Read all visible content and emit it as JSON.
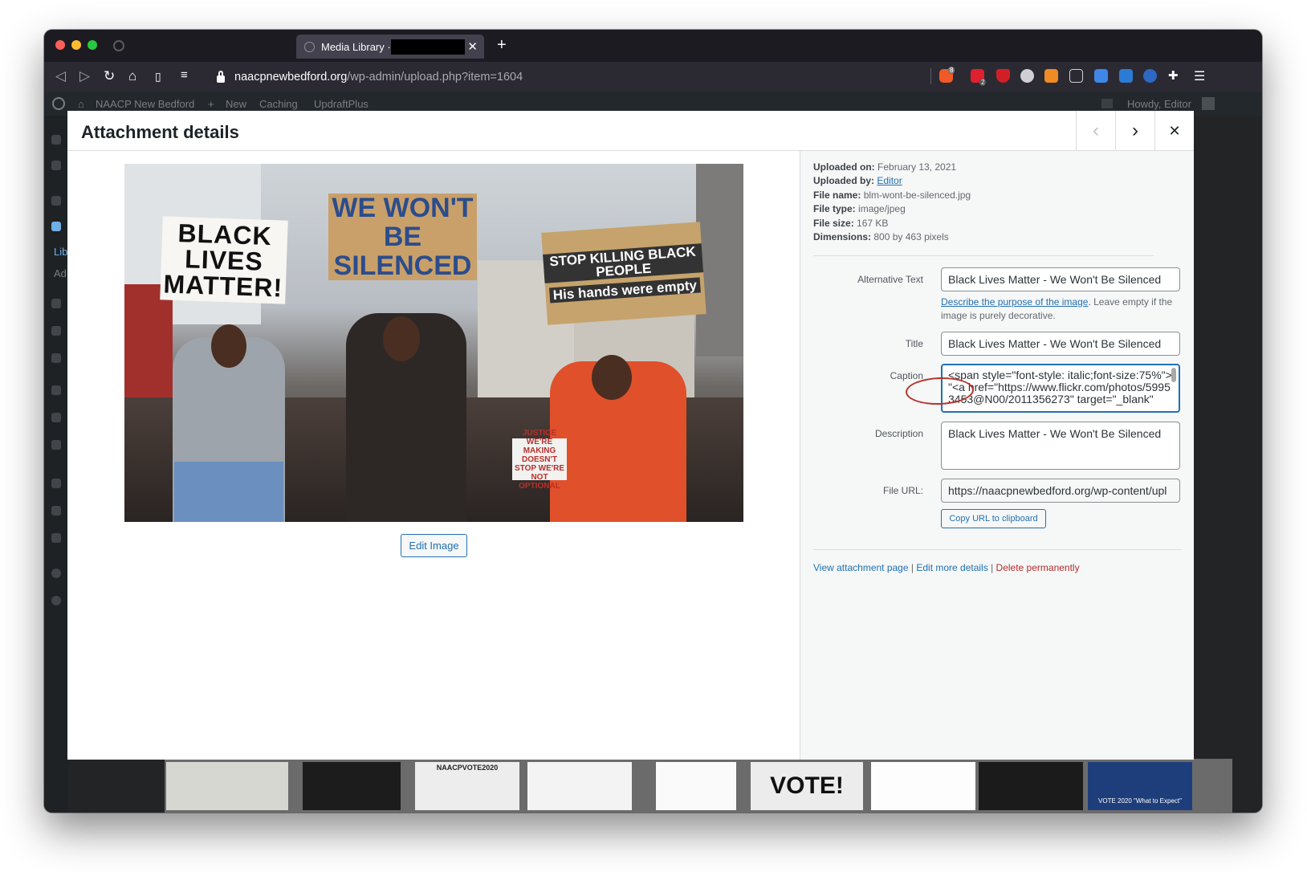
{
  "browser": {
    "tab_title": "Media Library ·",
    "url_host": "naacpnewbedford.org",
    "url_path": "/wp-admin/upload.php?item=1604",
    "brave_badge": "8",
    "ext_badge": "2"
  },
  "admin_bar": {
    "site_name": "NAACP New Bedford",
    "new_label": "New",
    "caching_label": "Caching",
    "updraft_label": "UpdraftPlus",
    "howdy": "Howdy, Editor"
  },
  "sidebar": {
    "lib_label": "Lib",
    "add_label": "Ad"
  },
  "modal": {
    "title": "Attachment details",
    "prev_icon": "‹",
    "next_icon": "›",
    "close_icon": "✕",
    "edit_image_label": "Edit Image"
  },
  "photo": {
    "sign1": "BLACK LIVES MATTER!",
    "sign2": "WE WON'T BE SILENCED",
    "sign3_a": "STOP KILLING BLACK PEOPLE",
    "sign3_b": "His hands were empty",
    "sign4": "JUSTICE WE'RE MAKING DOESN'T STOP WE'RE NOT OPTIONAL"
  },
  "info": {
    "uploaded_on_label": "Uploaded on:",
    "uploaded_on": "February 13, 2021",
    "uploaded_by_label": "Uploaded by:",
    "uploaded_by": "Editor",
    "file_name_label": "File name:",
    "file_name": "blm-wont-be-silenced.jpg",
    "file_type_label": "File type:",
    "file_type": "image/jpeg",
    "file_size_label": "File size:",
    "file_size": "167 KB",
    "dimensions_label": "Dimensions:",
    "dimensions": "800 by 463 pixels"
  },
  "fields": {
    "alt_label": "Alternative Text",
    "alt_value": "Black Lives Matter - We Won't Be Silenced",
    "alt_help_link": "Describe the purpose of the image",
    "alt_help_rest": ". Leave empty if the image is purely decorative.",
    "title_label": "Title",
    "title_value": "Black Lives Matter - We Won't Be Silenced",
    "caption_label": "Caption",
    "caption_value": "<span style=\"font-style: italic;font-size:75%\"> \"<a href=\"https://www.flickr.com/photos/59953453@N00/2011356273\" target=\"_blank\"",
    "description_label": "Description",
    "description_value": "Black Lives Matter - We Won't Be Silenced",
    "file_url_label": "File URL:",
    "file_url_value": "https://naacpnewbedford.org/wp-content/upl",
    "copy_url_label": "Copy URL to clipboard"
  },
  "actions": {
    "view_page": "View attachment page",
    "edit_details": "Edit more details",
    "delete": "Delete permanently",
    "sep": "|"
  },
  "thumbnails": {
    "vote_text": "VOTE!",
    "naacpvote_text": "NAACPVOTE2020",
    "expect_text": "VOTE 2020 \"What to Expect\""
  },
  "colors": {
    "accent": "#2271b1",
    "delete": "#b32d2e",
    "annotation": "#b7332c"
  }
}
